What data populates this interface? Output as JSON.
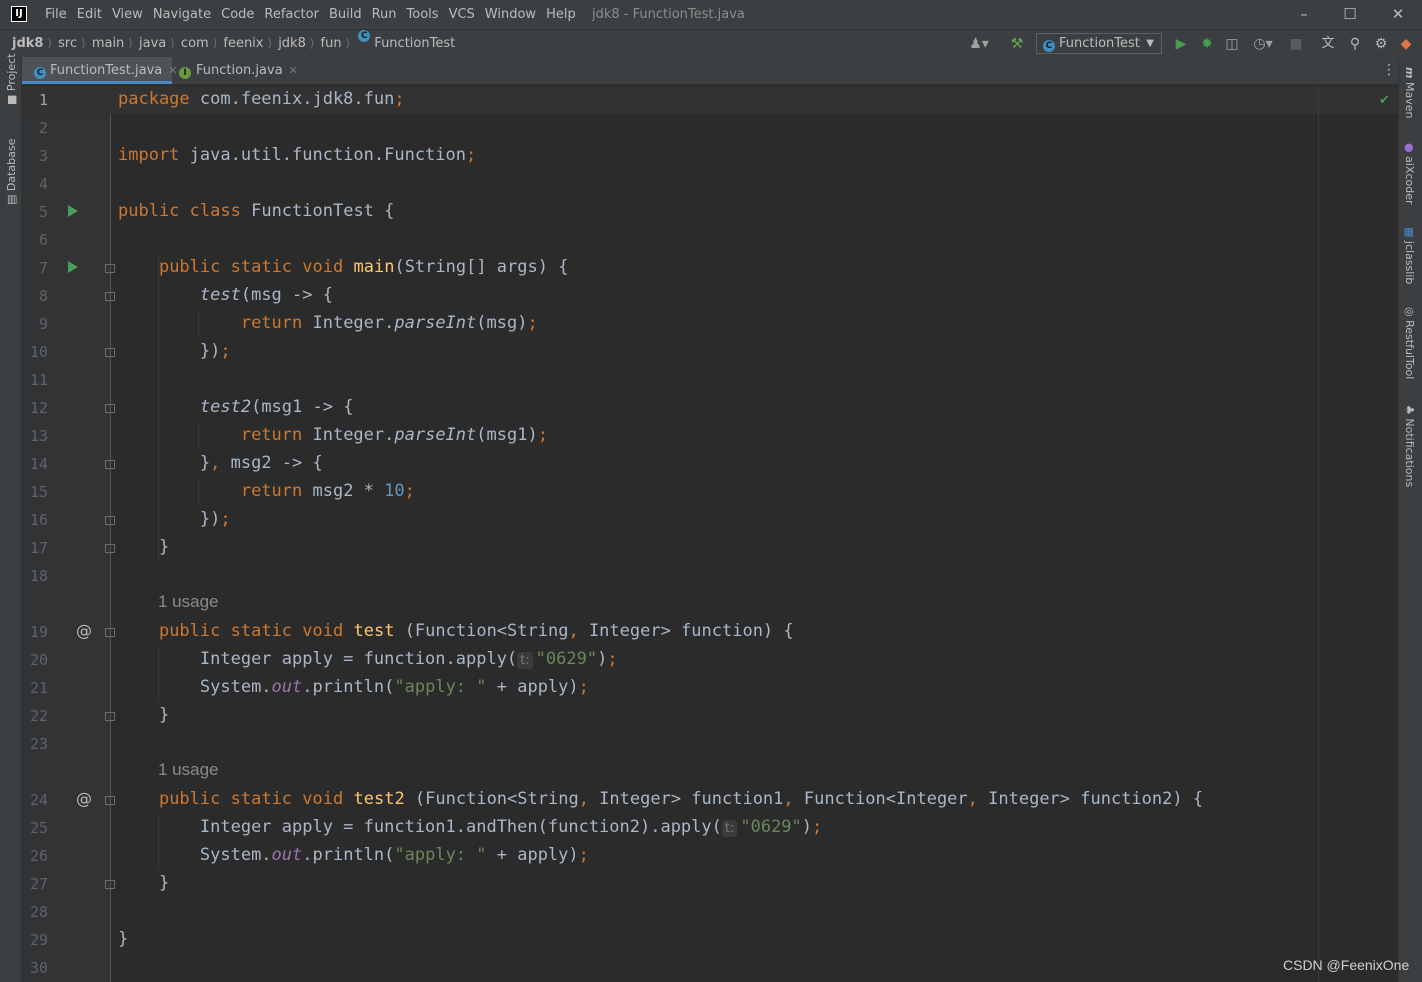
{
  "window": {
    "app_icon_text": "IJ",
    "title": "jdk8 - FunctionTest.java",
    "controls": [
      "minimize-icon",
      "maximize-icon",
      "close-icon"
    ]
  },
  "menu": [
    "File",
    "Edit",
    "View",
    "Navigate",
    "Code",
    "Refactor",
    "Build",
    "Run",
    "Tools",
    "VCS",
    "Window",
    "Help"
  ],
  "breadcrumb": [
    "jdk8",
    "src",
    "main",
    "java",
    "com",
    "feenix",
    "jdk8",
    "fun",
    "FunctionTest"
  ],
  "toolbar": {
    "run_config": "FunctionTest",
    "icons": [
      "user-icon",
      "build-hammer-icon",
      "run-icon",
      "debug-icon",
      "coverage-icon",
      "profile-icon",
      "stop-icon",
      "translate-icon",
      "search-icon",
      "settings-icon",
      "jetbrains-icon"
    ]
  },
  "tabs": [
    {
      "label": "FunctionTest.java",
      "icon": "C",
      "active": true
    },
    {
      "label": "Function.java",
      "icon": "I",
      "active": false
    }
  ],
  "left_tool_windows": [
    "Project",
    "Database"
  ],
  "right_tool_windows": [
    "Maven",
    "aiXcoder",
    "jclasslib",
    "RestfulTool",
    "Notifications"
  ],
  "editor": {
    "line_numbers": [
      "1",
      "2",
      "3",
      "4",
      "5",
      "6",
      "7",
      "8",
      "9",
      "10",
      "11",
      "12",
      "13",
      "14",
      "15",
      "16",
      "17",
      "18",
      "19",
      "20",
      "21",
      "22",
      "23",
      "24",
      "25",
      "26",
      "27",
      "28",
      "29",
      "30"
    ],
    "inlay_usage": "1 usage",
    "param_hint": "t:",
    "code": {
      "l1_kw": "package",
      "l1_rest": " com.feenix.jdk8.fun",
      "semi": ";",
      "l3_kw": "import",
      "l3_rest": " java.util.function.Function",
      "public": "public",
      "static": "static",
      "void": "void",
      "class": "class",
      "return": "return",
      "class_name": " FunctionTest {",
      "main": "main",
      "main_params": "(String[] args) {",
      "test": "test",
      "test2": "test2",
      "l8_rest": "(msg -> {",
      "integer_cls": " Integer.",
      "parse_int": "parseInt",
      "l9_arg": "(msg)",
      "close_lambda": "})",
      "l12_rest": "(msg1 -> {",
      "l13_arg": "(msg1)",
      "l14_a": "}",
      "comma": ",",
      "l14_b": " msg2 -> {",
      "l15_a": " msg2 * ",
      "l15_num": "10",
      "close_brace": "}",
      "l19_params_a": " (Function<String",
      "l19_params_b": " Integer> function) {",
      "l20_a": "Integer apply = function.apply(",
      "str_0629": "\"0629\"",
      "close_paren": ")",
      "l21_a": "System.",
      "out": "out",
      "l21_b": ".println(",
      "str_apply": "\"apply: \"",
      "l21_c": " + apply)",
      "l24_a": " (Function<String",
      "l24_b": " Integer> function1",
      "l24_c": " Function<Integer",
      "l24_d": " Integer> function2) {",
      "l25_a": "Integer apply = function1.andThen(function2).apply("
    }
  },
  "watermark": "CSDN @FeenixOne"
}
